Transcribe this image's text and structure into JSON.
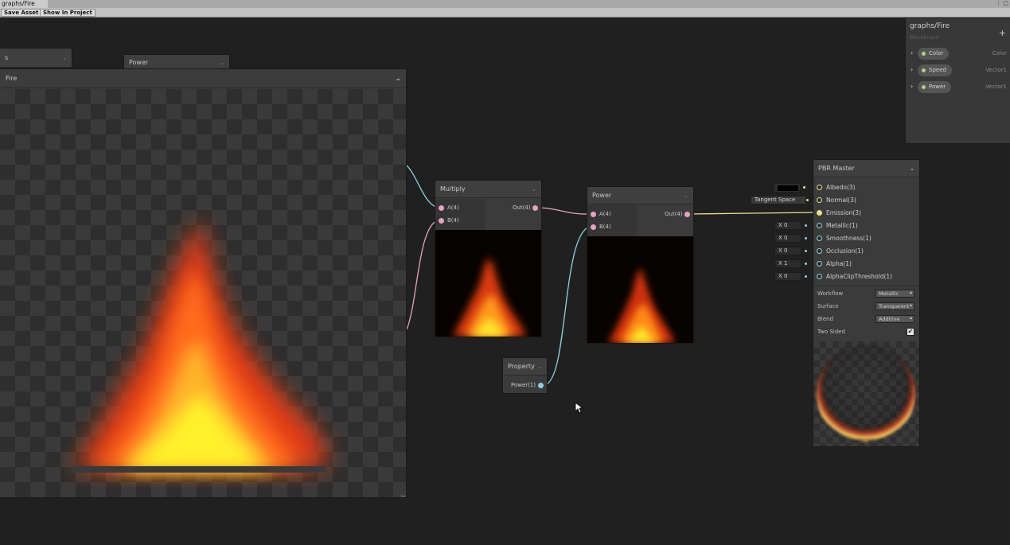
{
  "window": {
    "tab_title": "graphs/Fire",
    "tab_icons": "⋮ □"
  },
  "toolbar": {
    "save_asset": "Save Asset",
    "show_in_project": "Show In Project"
  },
  "preview_window": {
    "tab_small_label": "s",
    "tab_power_label": "Power",
    "title": "Fire",
    "resize_glyph": "—"
  },
  "nodes": {
    "multiply": {
      "title": "Multiply",
      "inputs": [
        "A(4)",
        "B(4)"
      ],
      "output": "Out(4)"
    },
    "power": {
      "title": "Power",
      "inputs": [
        "A(4)",
        "B(4)"
      ],
      "output": "Out(4)"
    },
    "property": {
      "title": "Property",
      "output": "Power(1)"
    }
  },
  "pbr_master": {
    "title": "PBR Master",
    "inputs": [
      {
        "label": "Albedo(3)",
        "port_color": "#e4e28a"
      },
      {
        "label": "Normal(3)",
        "port_color": "#e4e28a"
      },
      {
        "label": "Emission(3)",
        "port_color": "#e4e28a"
      },
      {
        "label": "Metallic(1)",
        "port_color": "#8fd0df"
      },
      {
        "label": "Smoothness(1)",
        "port_color": "#8fd0df"
      },
      {
        "label": "Occlusion(1)",
        "port_color": "#8fd0df"
      },
      {
        "label": "Alpha(1)",
        "port_color": "#8fd0df"
      },
      {
        "label": "AlphaClipThreshold(1)",
        "port_color": "#8fd0df"
      }
    ],
    "inline_values": {
      "normal_space": "Tangent Space",
      "metallic": "X 0",
      "smoothness": "X 0",
      "occlusion": "X 0",
      "alpha": "X 1",
      "alpha_clip": "X 0"
    },
    "settings": [
      {
        "label": "Workflow",
        "value": "Metallic"
      },
      {
        "label": "Surface",
        "value": "Transparent"
      },
      {
        "label": "Blend",
        "value": "Additive"
      }
    ],
    "two_sided": {
      "label": "Two Sided",
      "checked": true,
      "check_glyph": "✔"
    }
  },
  "blackboard": {
    "title": "graphs/Fire",
    "subtitle": "Blackboard",
    "add_glyph": "+",
    "properties": [
      {
        "name": "Color",
        "type": "Color"
      },
      {
        "name": "Speed",
        "type": "Vector1"
      },
      {
        "name": "Power",
        "type": "Vector1"
      }
    ]
  },
  "glyphs": {
    "chevron": "⌄",
    "expand": "›"
  },
  "colors": {
    "edge_pink": "#e7a2c4",
    "edge_cyan": "#8fd0df",
    "edge_yellow": "#e4e28a",
    "canvas_bg": "#202020",
    "node_bg": "#3b3b3b"
  }
}
